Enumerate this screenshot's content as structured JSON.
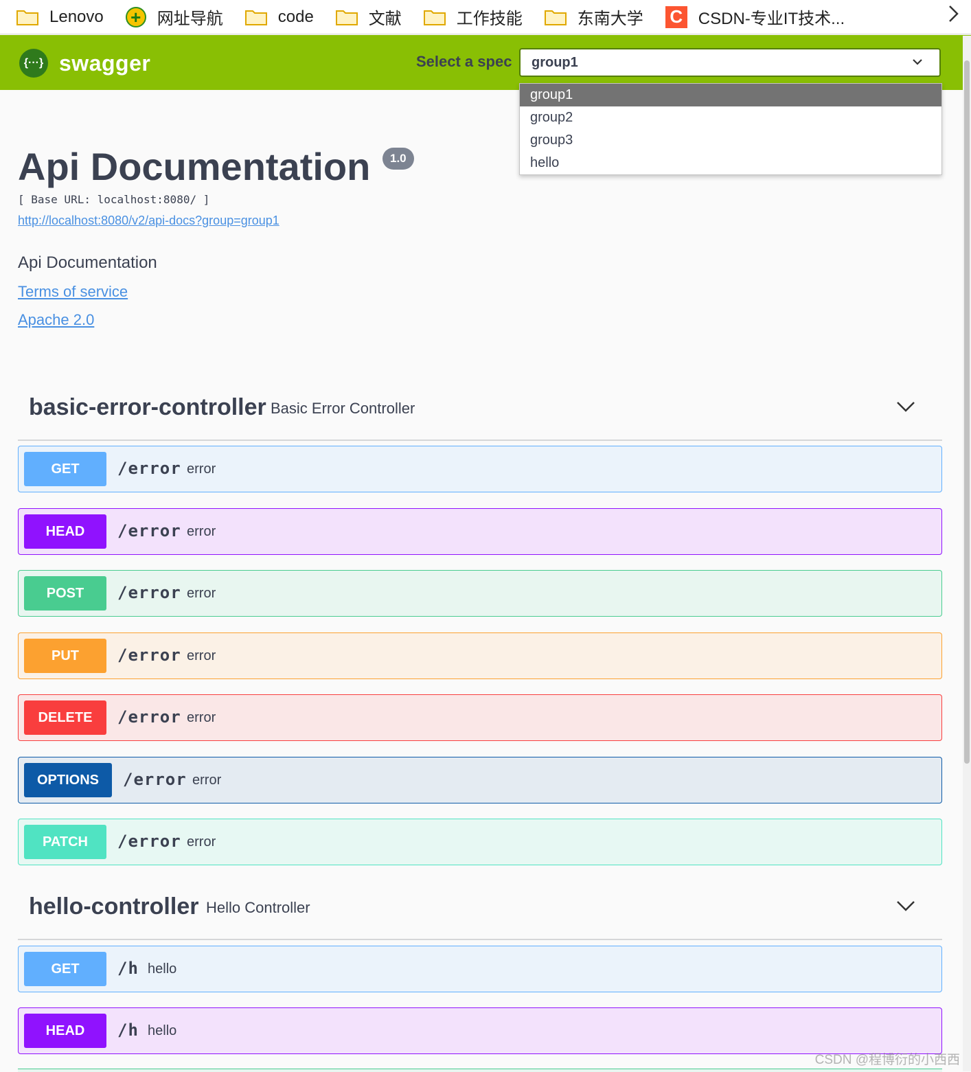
{
  "bookmarks": {
    "items": [
      {
        "label": "Lenovo",
        "icon": "folder-icon"
      },
      {
        "label": "网址导航",
        "icon": "plus-icon"
      },
      {
        "label": "code",
        "icon": "folder-icon"
      },
      {
        "label": "文献",
        "icon": "folder-icon"
      },
      {
        "label": "工作技能",
        "icon": "folder-icon"
      },
      {
        "label": "东南大学",
        "icon": "folder-icon"
      },
      {
        "label": "CSDN-专业IT技术...",
        "icon": "csdn-icon"
      }
    ],
    "more_icon": "chevron-right-icon",
    "csdn_letter": "C",
    "plus_glyph": "+"
  },
  "topbar": {
    "brand": "swagger",
    "logo_glyph": "{···}",
    "select_label": "Select a spec",
    "selected_spec": "group1",
    "options": [
      "group1",
      "group2",
      "group3",
      "hello"
    ],
    "accent": "#89bf04"
  },
  "info": {
    "title": "Api Documentation",
    "version": "1.0",
    "base_url": "[ Base URL: localhost:8080/ ]",
    "spec_url": "http://localhost:8080/v2/api-docs?group=group1",
    "description": "Api Documentation",
    "terms": "Terms of service",
    "license": "Apache 2.0"
  },
  "tags": [
    {
      "name": "basic-error-controller",
      "description": "Basic Error Controller",
      "operations": [
        {
          "method": "GET",
          "path": "/error",
          "summary": "error"
        },
        {
          "method": "HEAD",
          "path": "/error",
          "summary": "error"
        },
        {
          "method": "POST",
          "path": "/error",
          "summary": "error"
        },
        {
          "method": "PUT",
          "path": "/error",
          "summary": "error"
        },
        {
          "method": "DELETE",
          "path": "/error",
          "summary": "error"
        },
        {
          "method": "OPTIONS",
          "path": "/error",
          "summary": "error"
        },
        {
          "method": "PATCH",
          "path": "/error",
          "summary": "error"
        }
      ]
    },
    {
      "name": "hello-controller",
      "description": "Hello Controller",
      "operations": [
        {
          "method": "GET",
          "path": "/h",
          "summary": "hello"
        },
        {
          "method": "HEAD",
          "path": "/h",
          "summary": "hello"
        }
      ]
    }
  ],
  "method_colors": {
    "GET": "#61affe",
    "HEAD": "#9012fe",
    "POST": "#49cc90",
    "PUT": "#fca130",
    "DELETE": "#f93e3e",
    "OPTIONS": "#0d5aa7",
    "PATCH": "#50e3c2"
  },
  "watermark": "CSDN @程博衍的小西西"
}
